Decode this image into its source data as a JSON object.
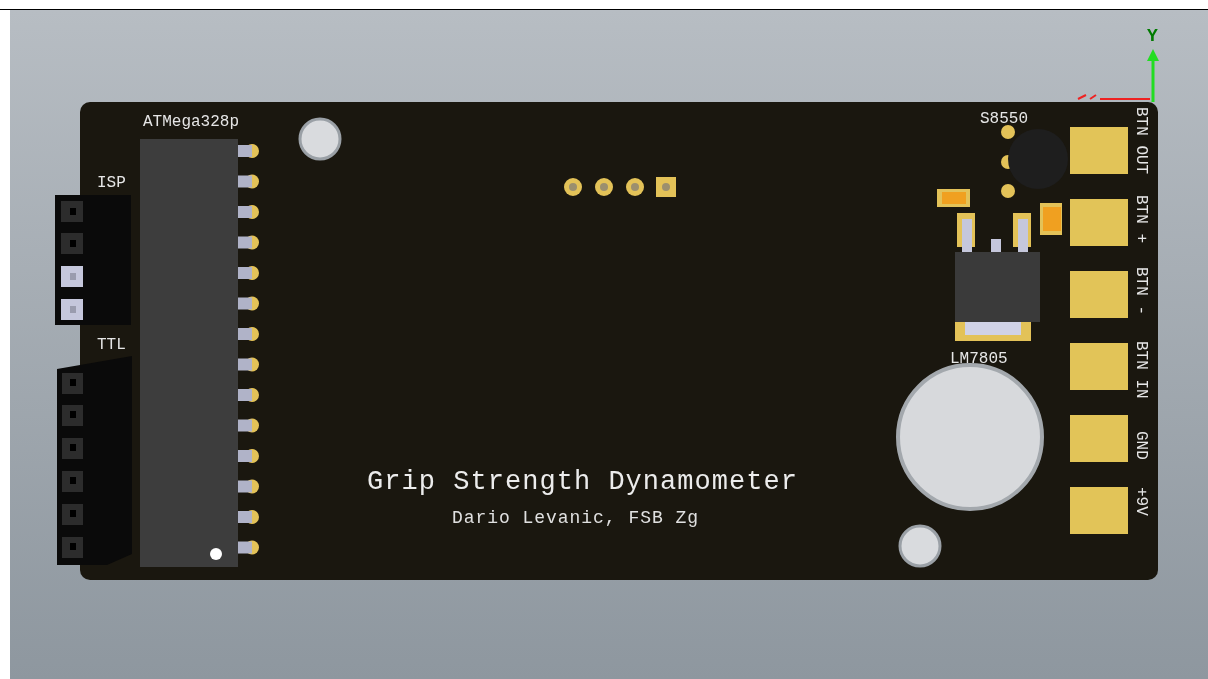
{
  "viewer": {
    "axis_label": "Y"
  },
  "board": {
    "silkscreen": [
      {
        "text": "ATMega328p"
      },
      {
        "text": "ISP"
      },
      {
        "text": "TTL"
      },
      {
        "text": "S8550"
      },
      {
        "text": "LM7805"
      }
    ],
    "title": "Grip Strength Dynamometer",
    "author": "Dario Levanic, FSB Zg",
    "terminals": [
      {
        "label": "BTN OUT"
      },
      {
        "label": "BTN +"
      },
      {
        "label": "BTN -"
      },
      {
        "label": "BTN IN"
      },
      {
        "label": "GND"
      },
      {
        "label": "+9V"
      }
    ]
  }
}
